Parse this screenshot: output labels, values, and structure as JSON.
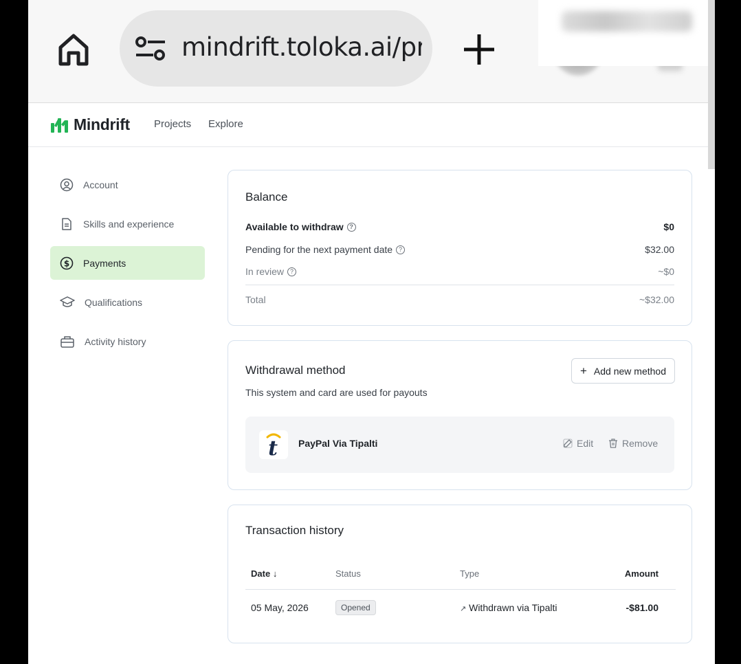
{
  "browser": {
    "url": "mindrift.toloka.ai/prc"
  },
  "app": {
    "brand": "Mindrift",
    "brand_color": "#22b455",
    "nav": [
      "Projects",
      "Explore"
    ]
  },
  "sidebar": {
    "items": [
      {
        "label": "Account",
        "icon": "user-circle-icon"
      },
      {
        "label": "Skills and experience",
        "icon": "document-icon"
      },
      {
        "label": "Payments",
        "icon": "dollar-circle-icon",
        "active": true
      },
      {
        "label": "Qualifications",
        "icon": "graduation-cap-icon"
      },
      {
        "label": "Activity history",
        "icon": "briefcase-icon"
      }
    ],
    "active_color": "#dcf3d6"
  },
  "balance": {
    "title": "Balance",
    "rows": [
      {
        "label": "Available to withdraw",
        "value": "$0"
      },
      {
        "label": "Pending for the next payment date",
        "value": "$32.00"
      },
      {
        "label": "In review",
        "value": "~$0"
      },
      {
        "label": "Total",
        "value": "~$32.00"
      }
    ]
  },
  "withdrawal": {
    "title": "Withdrawal method",
    "subtitle": "This system and card are used for payouts",
    "add_button": "Add new method",
    "method": {
      "name": "PayPal Via Tipalti",
      "logo_letter": "t",
      "edit_label": "Edit",
      "remove_label": "Remove"
    }
  },
  "transactions": {
    "title": "Transaction history",
    "columns": [
      "Date",
      "Status",
      "Type",
      "Amount"
    ],
    "rows": [
      {
        "date": "05 May, 2026",
        "status": "Opened",
        "type": "Withdrawn via Tipalti",
        "amount": "-$81.00"
      }
    ]
  }
}
